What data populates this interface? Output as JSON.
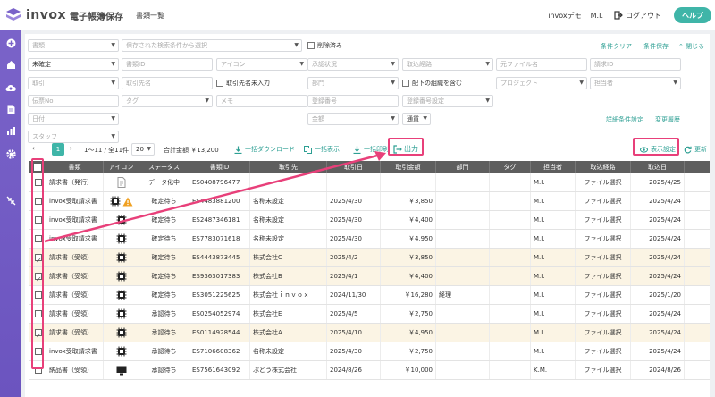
{
  "header": {
    "brand": "invox",
    "brand_sub": "電子帳簿保存",
    "page_title": "書類一覧",
    "user_name": "invoxデモ",
    "user_initials": "M.I.",
    "logout": "ログアウト",
    "help": "ヘルプ"
  },
  "filters": {
    "doc_type": "書類",
    "saved_search": "保存された検索条件から選択",
    "deleted_label": "削除済み",
    "condition_clear": "条件クリア",
    "condition_save": "条件保存",
    "close": "閉じる",
    "unconfirmed": "未確定",
    "doc_id": "書類ID",
    "icon": "アイコン",
    "approval_status": "承認状況",
    "import_route": "取込経路",
    "original_filename": "元ファイル名",
    "request_id": "請求ID",
    "transaction": "取引",
    "partner_name": "取引先名",
    "partner_not_entered": "取引先名未入力",
    "department": "部門",
    "include_sub_org": "配下の組織を含む",
    "project": "プロジェクト",
    "person_in_charge": "担当者",
    "slip_no": "伝票No",
    "tag": "タグ",
    "memo": "メモ",
    "registration_no": "登録番号",
    "registration_status": "登録番号設定",
    "date": "日付",
    "amount": "金額",
    "currency": "通貨",
    "staff": "スタッフ",
    "detail_settings": "詳細条件設定",
    "change_history": "変更履歴"
  },
  "toolbar": {
    "page": "1",
    "range": "1〜11 / 全11件",
    "per_page": "20",
    "total_amount": "合計金額 ￥13,200",
    "bulk_download": "一括ダウンロード",
    "bulk_display": "一括表示",
    "bulk_print": "一括印刷",
    "export": "出力",
    "display_settings": "表示設定",
    "refresh": "更新"
  },
  "table": {
    "columns": [
      "書類",
      "アイコン",
      "ステータス",
      "書類ID",
      "取引先",
      "取引日",
      "取引金額",
      "部門",
      "タグ",
      "担当者",
      "取込経路",
      "取込日"
    ],
    "rows": [
      {
        "checked": false,
        "doc": "請求書（発行）",
        "icon": "doc",
        "status": "データ化中",
        "id": "ES0408796477",
        "partner": "",
        "date": "",
        "amount": "",
        "dept": "",
        "tag": "",
        "person": "M.I.",
        "route": "ファイル選択",
        "imported": "2025/4/25"
      },
      {
        "checked": false,
        "doc": "invox受取請求書",
        "icon": "chip-warn",
        "status": "確定待ち",
        "id": "ES4483881200",
        "partner": "名称未設定",
        "date": "2025/4/30",
        "amount": "￥3,850",
        "dept": "",
        "tag": "",
        "person": "M.I.",
        "route": "ファイル選択",
        "imported": "2025/4/24"
      },
      {
        "checked": false,
        "doc": "invox受取請求書",
        "icon": "chip",
        "status": "確定待ち",
        "id": "ES2487346181",
        "partner": "名称未設定",
        "date": "2025/4/30",
        "amount": "￥4,400",
        "dept": "",
        "tag": "",
        "person": "M.I.",
        "route": "ファイル選択",
        "imported": "2025/4/24"
      },
      {
        "checked": false,
        "doc": "invox受取請求書",
        "icon": "chip",
        "status": "確定待ち",
        "id": "ES7783071618",
        "partner": "名称未設定",
        "date": "2025/4/30",
        "amount": "￥4,950",
        "dept": "",
        "tag": "",
        "person": "M.I.",
        "route": "ファイル選択",
        "imported": "2025/4/24"
      },
      {
        "checked": true,
        "doc": "請求書（受領）",
        "icon": "chip",
        "status": "確定待ち",
        "id": "ES4443873445",
        "partner": "株式会社C",
        "date": "2025/4/2",
        "amount": "￥3,850",
        "dept": "",
        "tag": "",
        "person": "M.I.",
        "route": "ファイル選択",
        "imported": "2025/4/24"
      },
      {
        "checked": true,
        "doc": "請求書（受領）",
        "icon": "chip",
        "status": "確定待ち",
        "id": "ES9363017383",
        "partner": "株式会社B",
        "date": "2025/4/1",
        "amount": "￥4,400",
        "dept": "",
        "tag": "",
        "person": "M.I.",
        "route": "ファイル選択",
        "imported": "2025/4/24"
      },
      {
        "checked": false,
        "doc": "請求書（受領）",
        "icon": "chip",
        "status": "確定待ち",
        "id": "ES3051225625",
        "partner": "株式会社ｉｎｖｏｘ",
        "date": "2024/11/30",
        "amount": "￥16,280",
        "dept": "経理",
        "tag": "",
        "person": "M.I.",
        "route": "ファイル選択",
        "imported": "2025/1/20"
      },
      {
        "checked": false,
        "doc": "請求書（受領）",
        "icon": "chip",
        "status": "承認待ち",
        "id": "ES0254052974",
        "partner": "株式会社E",
        "date": "2025/4/5",
        "amount": "￥2,750",
        "dept": "",
        "tag": "",
        "person": "M.I.",
        "route": "ファイル選択",
        "imported": "2025/4/24"
      },
      {
        "checked": true,
        "doc": "請求書（受領）",
        "icon": "chip",
        "status": "承認待ち",
        "id": "ES0114928544",
        "partner": "株式会社A",
        "date": "2025/4/10",
        "amount": "￥4,950",
        "dept": "",
        "tag": "",
        "person": "M.I.",
        "route": "ファイル選択",
        "imported": "2025/4/24"
      },
      {
        "checked": false,
        "doc": "invox受取請求書",
        "icon": "chip",
        "status": "承認待ち",
        "id": "ES7106608362",
        "partner": "名称未設定",
        "date": "2025/4/30",
        "amount": "￥2,750",
        "dept": "",
        "tag": "",
        "person": "M.I.",
        "route": "ファイル選択",
        "imported": "2025/4/24"
      },
      {
        "checked": false,
        "doc": "納品書（受領）",
        "icon": "monitor",
        "status": "承認待ち",
        "id": "ES7561643092",
        "partner": "ぶどう株式会社",
        "date": "2024/8/26",
        "amount": "￥10,000",
        "dept": "",
        "tag": "",
        "person": "K.M.",
        "route": "ファイル選択",
        "imported": "2024/8/26"
      }
    ]
  },
  "colors": {
    "accent": "#3fb5a8",
    "sidebar": "#7a63c9",
    "highlight": "#e8407a",
    "selected_row": "#fbf4e4"
  }
}
